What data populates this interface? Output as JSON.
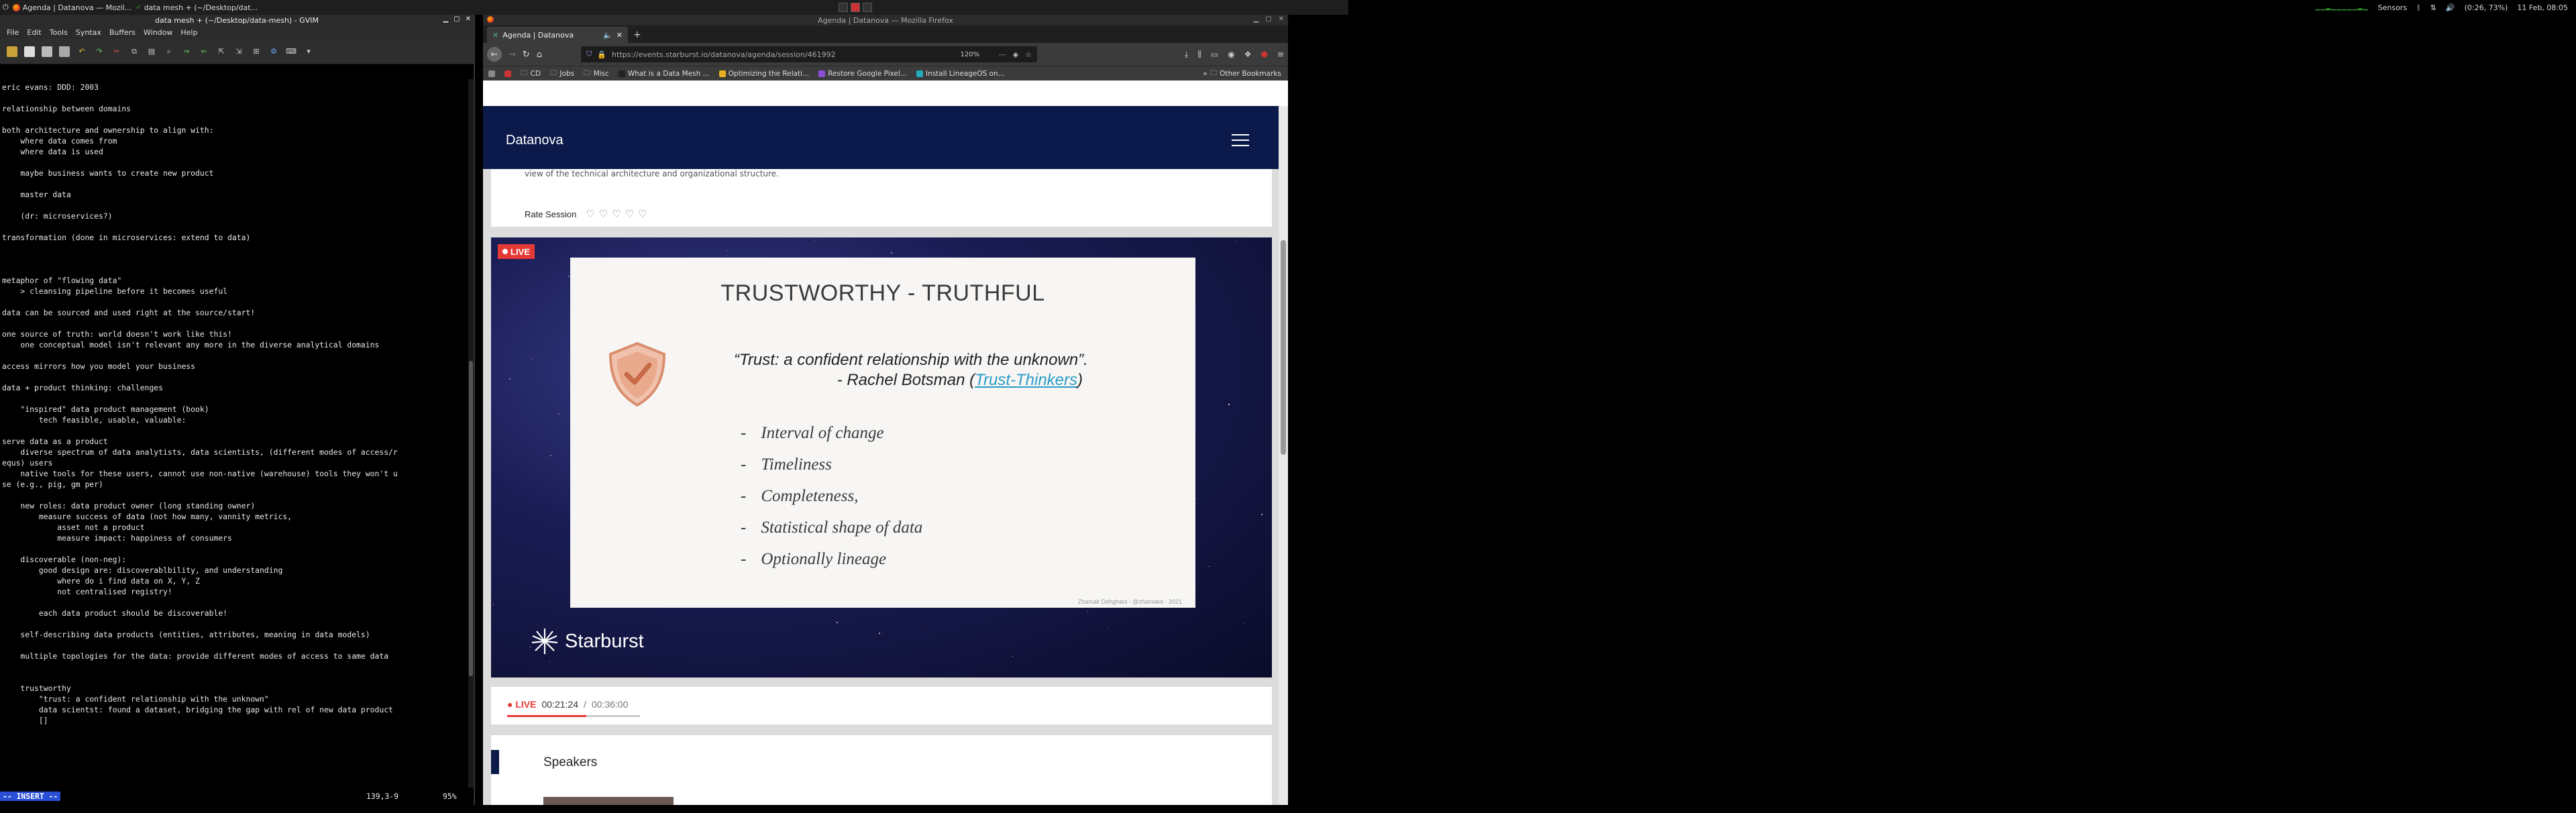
{
  "panel": {
    "tasks": [
      {
        "label": "Agenda | Datanova — Mozil..."
      },
      {
        "label": "data mesh + (~/Desktop/dat..."
      }
    ],
    "sensors": "Sensors",
    "battery": "(0:26, 73%)",
    "clock": "11 Feb, 08:05"
  },
  "gvim": {
    "title": "data mesh + (~/Desktop/data-mesh) - GVIM",
    "menu": [
      "File",
      "Edit",
      "Tools",
      "Syntax",
      "Buffers",
      "Window",
      "Help"
    ],
    "lines": [
      "eric evans: DDD: 2003",
      "",
      "relationship between domains",
      "",
      "both architecture and ownership to align with:",
      "    where data comes from",
      "    where data is used",
      "",
      "    maybe business wants to create new product",
      "",
      "    master data",
      "",
      "    (dr: microservices?)",
      "",
      "transformation (done in microservices: extend to data)",
      "",
      "",
      "",
      "metaphor of \"flowing data\"",
      "    > cleansing pipeline before it becomes useful",
      "",
      "data can be sourced and used right at the source/start!",
      "",
      "one source of truth: world doesn't work like this!",
      "    one conceptual model isn't relevant any more in the diverse analytical domains",
      "",
      "access mirrors how you model your business",
      "",
      "data + product thinking: challenges",
      "",
      "    \"inspired\" data product management (book)",
      "        tech feasible, usable, valuable:",
      "",
      "serve data as a product",
      "    diverse spectrum of data analytists, data scientists, (different modes of access/r",
      "equs) users",
      "    native tools for these users, cannot use non-native (warehouse) tools they won't u",
      "se (e.g., pig, gm per)",
      "",
      "    new roles: data product owner (long standing owner)",
      "        measure success of data (not how many, vannity metrics,",
      "            asset not a product",
      "            measure impact: happiness of consumers",
      "",
      "    discoverable (non-neg):",
      "        good design are: discoverablbility, and understanding",
      "            where do i find data on X, Y, Z",
      "            not centralised registry!",
      "",
      "        each data product should be discoverable!",
      "",
      "    self-describing data products (entities, attributes, meaning in data models)",
      "",
      "    multiple topologies for the data: provide different modes of access to same data",
      "",
      "",
      "    trustworthy",
      "        \"trust: a confident relationship with the unknown\"",
      "        data scientst: found a dataset, bridging the gap with rel of new data product",
      "        []"
    ],
    "status_mode": "-- INSERT --",
    "status_pos": "139,3-9",
    "status_pct": "95%"
  },
  "firefox": {
    "window_title": "Agenda | Datanova — Mozilla Firefox",
    "tab_title": "Agenda | Datanova",
    "url": "https://events.starburst.io/datanova/agenda/session/461992",
    "zoom": "120%",
    "bookmarks": [
      "CD",
      "Jobs",
      "Misc",
      "What is a Data Mesh ...",
      "Optimizing the Relati...",
      "Restore Google Pixel...",
      "Install LineageOS on..."
    ],
    "other_bookmarks": "Other Bookmarks"
  },
  "site": {
    "brand": "Datanova",
    "desc_fragment": "view of the technical architecture and organizational structure.",
    "rate_label": "Rate Session",
    "live_label": "LIVE",
    "slide_title": "TRUSTWORTHY - TRUTHFUL",
    "quote_text": "“Trust: a confident relationship with the unknown”.",
    "quote_by_prefix": "- Rachel Botsman (",
    "quote_link": "Trust-Thinkers",
    "quote_by_suffix": ")",
    "bullets": [
      "Interval of change",
      "Timeliness",
      "Completeness,",
      "Statistical shape of data",
      "Optionally lineage"
    ],
    "slide_credit": "Zhamak Dehghani - @zhamakd - 2021",
    "starburst": "Starburst",
    "player_live": "LIVE",
    "player_current": "00:21:24",
    "player_sep": "/",
    "player_total": "00:36:00",
    "player_progress": 0.594,
    "speakers_heading": "Speakers"
  }
}
